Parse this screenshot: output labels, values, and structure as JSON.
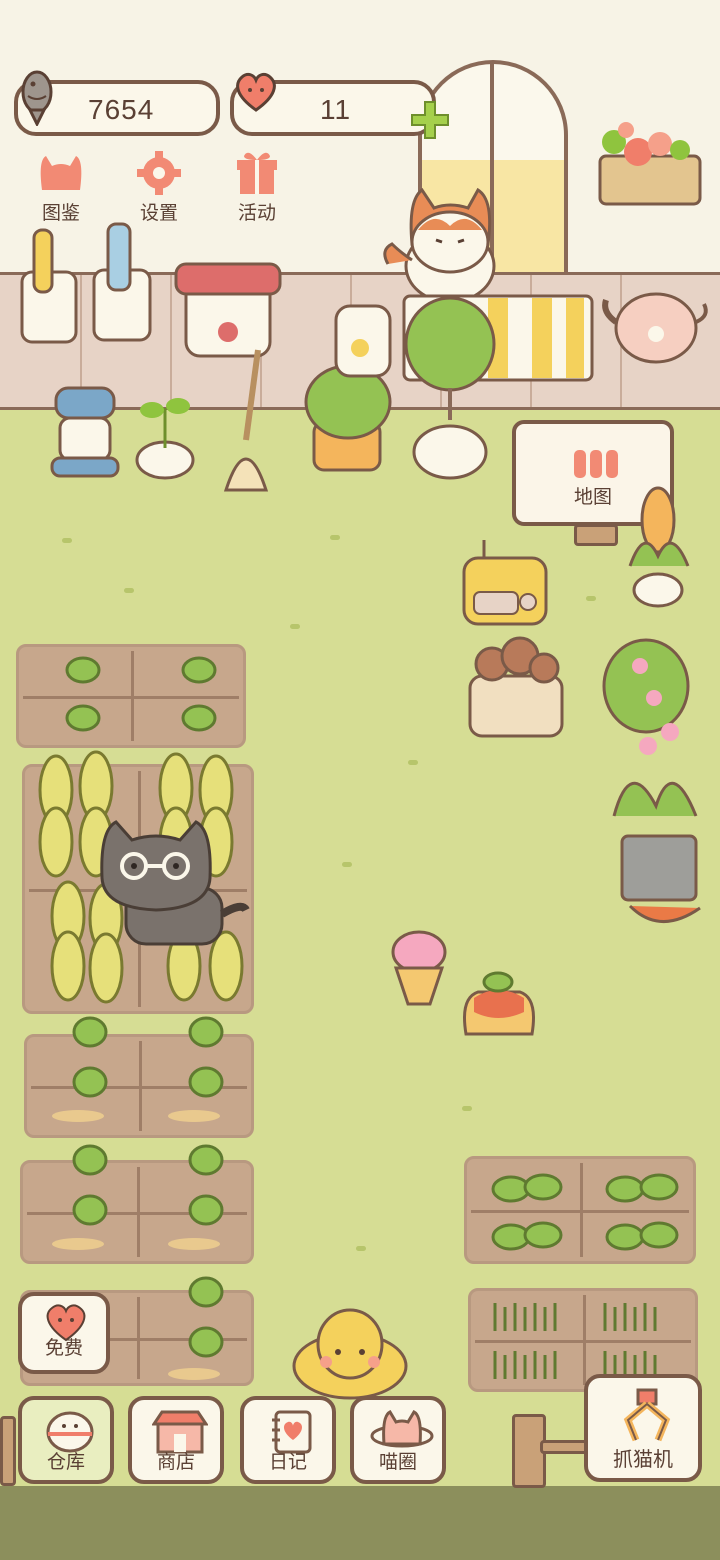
{
  "resources": {
    "fish_count": "7654",
    "heart_count": "11",
    "fish_icon": "fish-icon",
    "heart_icon": "heart-icon",
    "add_icon": "plus-icon"
  },
  "top_menu": [
    {
      "label": "图鉴",
      "icon": "cat-book-icon"
    },
    {
      "label": "设置",
      "icon": "gear-icon"
    },
    {
      "label": "活动",
      "icon": "gift-icon"
    }
  ],
  "map_sign": {
    "label": "地图",
    "icon": "fence-icon"
  },
  "free_button": {
    "label": "免费",
    "icon": "heart-icon"
  },
  "bottom_nav": [
    {
      "label": "仓库",
      "icon": "storage-icon",
      "active": true
    },
    {
      "label": "商店",
      "icon": "shop-icon",
      "active": false
    },
    {
      "label": "日记",
      "icon": "diary-icon",
      "active": false
    },
    {
      "label": "喵圈",
      "icon": "cat-planet-icon",
      "active": false
    }
  ],
  "claw_machine": {
    "label": "抓猫机",
    "icon": "claw-icon"
  },
  "colors": {
    "grass": "#d6dd94",
    "wall": "#f7f3e6",
    "counter": "#e7d3c6",
    "outline": "#7a5a48",
    "soil": "#c7a78c",
    "accent_pink": "#f07e6a",
    "accent_green": "#8fc43e"
  }
}
